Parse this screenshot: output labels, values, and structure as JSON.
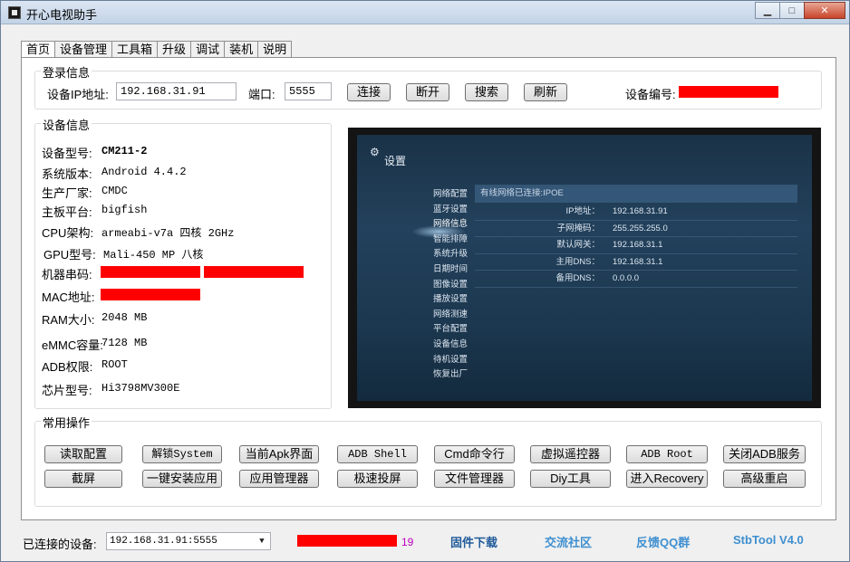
{
  "window": {
    "title": "开心电视助手",
    "minimize_glyph": "▁",
    "maximize_glyph": "□",
    "close_glyph": "✕"
  },
  "tabs": [
    {
      "label": "首页"
    },
    {
      "label": "设备管理"
    },
    {
      "label": "工具箱"
    },
    {
      "label": "升级"
    },
    {
      "label": "调试"
    },
    {
      "label": "装机"
    },
    {
      "label": "说明"
    }
  ],
  "login": {
    "group_title": "登录信息",
    "ip_label": "设备IP地址:",
    "ip_value": "192.168.31.91",
    "port_label": "端口:",
    "port_value": "5555",
    "connect_btn": "连接",
    "disconnect_btn": "断开",
    "search_btn": "搜索",
    "refresh_btn": "刷新",
    "device_no_label": "设备编号:"
  },
  "device_info": {
    "group_title": "设备信息",
    "rows": [
      {
        "label": "设备型号:",
        "value": "CM211-2"
      },
      {
        "label": "系统版本:",
        "value": "Android 4.4.2"
      },
      {
        "label": "生产厂家:",
        "value": "CMDC"
      },
      {
        "label": "主板平台:",
        "value": "bigfish"
      },
      {
        "label": "CPU架构:",
        "value": "armeabi-v7a 四核 2GHz"
      },
      {
        "label": "GPU型号:",
        "value": "Mali-450 MP 八核"
      },
      {
        "label": "机器串码:",
        "value": ""
      },
      {
        "label": "MAC地址:",
        "value": ""
      },
      {
        "label": "RAM大小:",
        "value": "2048 MB"
      },
      {
        "label": "eMMC容量:",
        "value": "7128 MB"
      },
      {
        "label": "ADB权限:",
        "value": "ROOT"
      },
      {
        "label": "芯片型号:",
        "value": "Hi3798MV300E"
      }
    ]
  },
  "tv_screen": {
    "gear_glyph": "⚙",
    "title": "设置",
    "menu": [
      "网络配置",
      "蓝牙设置",
      "网络信息",
      "智能排障",
      "系统升级",
      "日期时间",
      "图像设置",
      "播放设置",
      "网络测速",
      "平台配置",
      "设备信息",
      "待机设置",
      "恢复出厂"
    ],
    "active_menu_index": 2,
    "header": "有线网络已连接:IPOE",
    "rows": [
      {
        "key": "IP地址：",
        "value": "192.168.31.91"
      },
      {
        "key": "子网掩码：",
        "value": "255.255.255.0"
      },
      {
        "key": "默认网关：",
        "value": "192.168.31.1"
      },
      {
        "key": "主用DNS：",
        "value": "192.168.31.1"
      },
      {
        "key": "备用DNS：",
        "value": "0.0.0.0"
      }
    ]
  },
  "operations": {
    "group_title": "常用操作",
    "row1": [
      "读取配置",
      "解锁System",
      "当前Apk界面",
      "ADB Shell",
      "Cmd命令行",
      "虚拟遥控器",
      "ADB  Root",
      "关闭ADB服务"
    ],
    "row2": [
      "截屏",
      "一键安装应用",
      "应用管理器",
      "极速投屏",
      "文件管理器",
      "Diy工具",
      "进入Recovery",
      "高级重启"
    ]
  },
  "status_bar": {
    "connected_label": "已连接的设备:",
    "device_select": "192.168.31.91:5555",
    "counter": "19",
    "links": [
      {
        "label": "固件下载",
        "color": "#1f5a9a"
      },
      {
        "label": "交流社区",
        "color": "#3e8fd0"
      },
      {
        "label": "反馈QQ群",
        "color": "#3e8fd0"
      },
      {
        "label": "StbTool V4.0",
        "color": "#3e8fd0"
      }
    ]
  },
  "colors": {
    "redaction": "#ff0000",
    "counter": "#c000c0"
  }
}
